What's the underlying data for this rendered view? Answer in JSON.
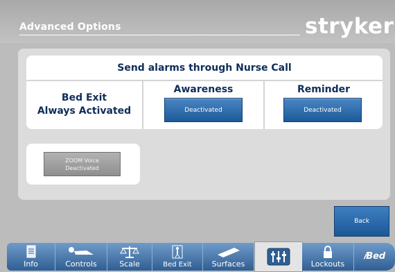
{
  "header": {
    "title": "Advanced Options",
    "logo_text": "stryker"
  },
  "nurse_call": {
    "heading": "Send alarms through Nurse Call",
    "bed_exit_line1": "Bed Exit",
    "bed_exit_line2": "Always Activated",
    "awareness_label": "Awareness",
    "awareness_button": "Deactivated",
    "reminder_label": "Reminder",
    "reminder_button": "Deactivated"
  },
  "zoom_voice": {
    "line1": "ZOOM Voice",
    "line2": "Deactivated"
  },
  "back_button": "Back",
  "tabs": [
    {
      "label": "Info",
      "icon": "info-icon"
    },
    {
      "label": "Controls",
      "icon": "patient-controls-icon"
    },
    {
      "label": "Scale",
      "icon": "scale-icon"
    },
    {
      "label": "Bed Exit",
      "icon": "bed-exit-icon"
    },
    {
      "label": "Surfaces",
      "icon": "surface-icon"
    },
    {
      "label": "",
      "icon": "settings-sliders-icon"
    },
    {
      "label": "Lockouts",
      "icon": "lock-icon"
    },
    {
      "label": "Bed",
      "icon": "ibed-icon"
    }
  ],
  "colors": {
    "accent_blue": "#1c5a99",
    "title_navy": "#0f2d5a",
    "panel_gray": "#dcdcdc"
  }
}
